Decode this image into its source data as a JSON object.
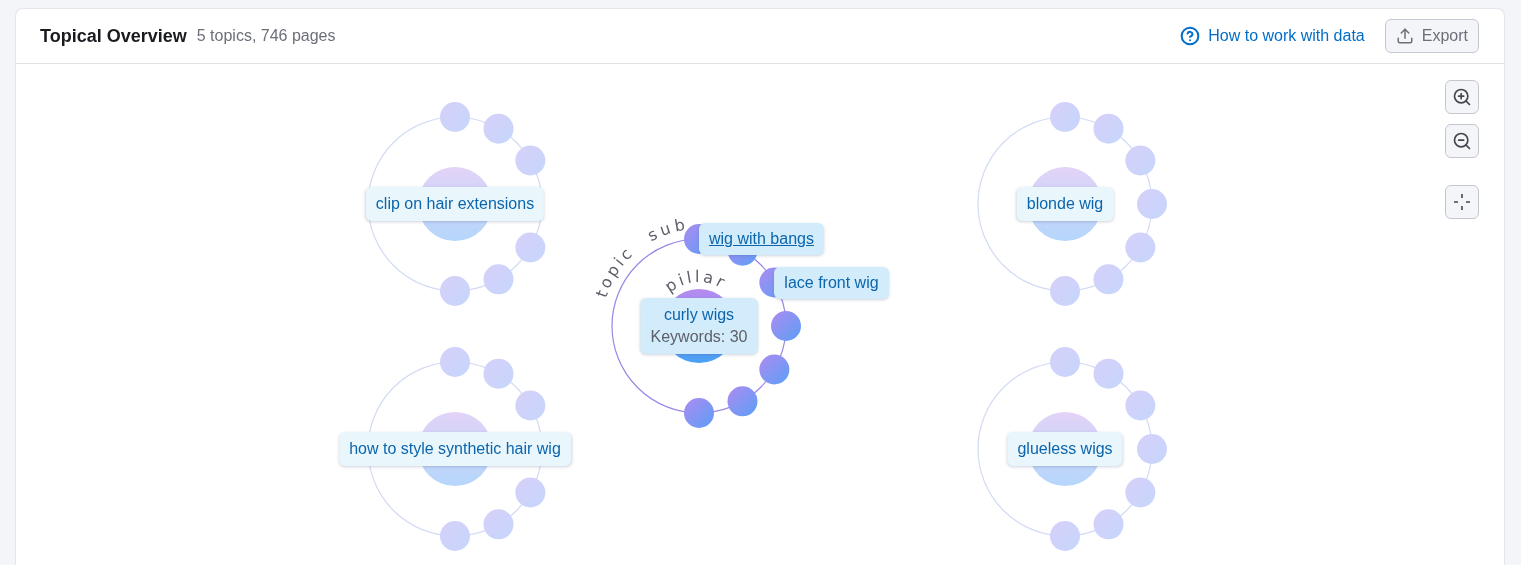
{
  "header": {
    "title": "Topical Overview",
    "summary": "5 topics, 746 pages",
    "help_link": "How to work with data",
    "export_button": "Export"
  },
  "arc_labels": [
    "topic",
    "sub",
    "pillar"
  ],
  "clusters": [
    {
      "label": "clip on hair extensions",
      "active": false,
      "nodes": [
        {
          "kind": "dot"
        },
        {
          "kind": "dot"
        },
        {
          "kind": "dot"
        },
        {
          "kind": "dot"
        },
        {
          "kind": "dot"
        },
        {
          "kind": "dot"
        }
      ]
    },
    {
      "label": "curly wigs",
      "detail": "Keywords: 30",
      "active": true,
      "nodes": [
        {
          "kind": "labeled",
          "label": "wig with bangs",
          "hovered": true
        },
        {
          "kind": "dot"
        },
        {
          "kind": "labeled",
          "label": "lace front wig",
          "hovered": false
        },
        {
          "kind": "dot"
        },
        {
          "kind": "dot"
        },
        {
          "kind": "dot"
        },
        {
          "kind": "dot"
        }
      ]
    },
    {
      "label": "blonde wig",
      "active": false,
      "nodes": [
        {
          "kind": "dot"
        },
        {
          "kind": "dot"
        },
        {
          "kind": "dot"
        },
        {
          "kind": "dot"
        },
        {
          "kind": "dot"
        },
        {
          "kind": "dot"
        },
        {
          "kind": "dot"
        }
      ]
    },
    {
      "label": "how to style synthetic hair wig",
      "active": false,
      "nodes": [
        {
          "kind": "dot"
        },
        {
          "kind": "dot"
        },
        {
          "kind": "dot"
        },
        {
          "kind": "dot"
        },
        {
          "kind": "dot"
        },
        {
          "kind": "dot"
        }
      ]
    },
    {
      "label": "glueless wigs",
      "active": false,
      "nodes": [
        {
          "kind": "dot"
        },
        {
          "kind": "dot"
        },
        {
          "kind": "dot"
        },
        {
          "kind": "dot"
        },
        {
          "kind": "dot"
        },
        {
          "kind": "dot"
        },
        {
          "kind": "dot"
        }
      ]
    }
  ]
}
